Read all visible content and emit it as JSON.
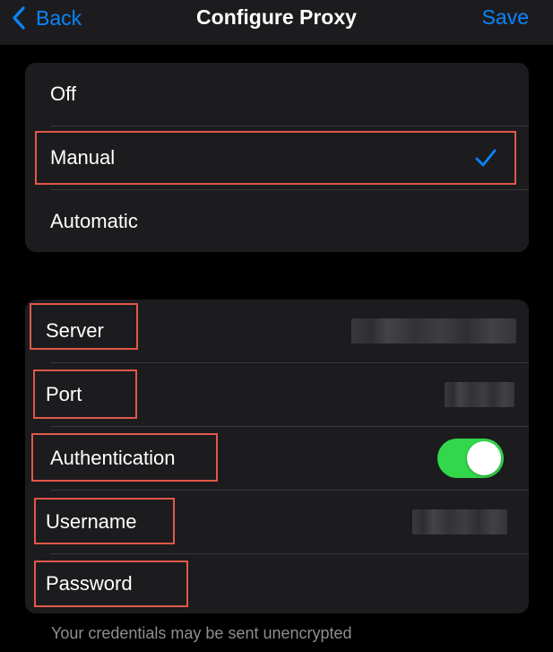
{
  "nav": {
    "back_label": "Back",
    "title": "Configure Proxy",
    "save_label": "Save"
  },
  "proxy_modes": {
    "options": [
      "Off",
      "Manual",
      "Automatic"
    ],
    "selected": "Manual"
  },
  "fields": {
    "server_label": "Server",
    "port_label": "Port",
    "authentication_label": "Authentication",
    "authentication_enabled": true,
    "username_label": "Username",
    "password_label": "Password"
  },
  "footer_note": "Your credentials may be sent unencrypted",
  "colors": {
    "accent": "#0a84ff",
    "toggle_on": "#32d74b",
    "highlight": "#e0574a",
    "background": "#000000",
    "group_bg": "#1c1c1e"
  },
  "icons": {
    "back": "chevron-left-icon",
    "selected": "checkmark-icon"
  }
}
